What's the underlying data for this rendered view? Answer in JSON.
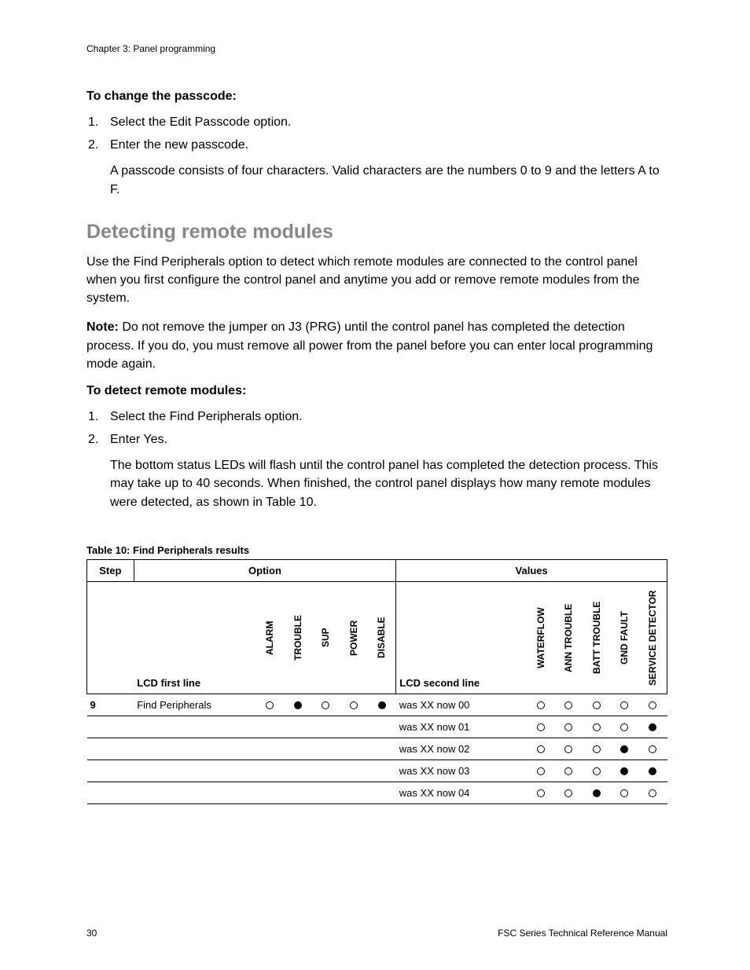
{
  "chapter": "Chapter 3: Panel programming",
  "passcode": {
    "heading": "To change the passcode:",
    "steps": [
      "Select the Edit Passcode option.",
      "Enter the new passcode."
    ],
    "followup": "A passcode consists of four characters. Valid characters are the numbers 0 to 9 and the letters A to F."
  },
  "section_title": "Detecting remote modules",
  "intro": "Use the Find Peripherals option to detect which remote modules are connected to the control panel when you first configure the control panel and anytime you add or remove remote modules from the system.",
  "note": {
    "label": "Note:",
    "text": " Do not remove the jumper on J3 (PRG) until the control panel has completed the detection process. If you do, you must remove all power from the panel before you can enter local programming mode again."
  },
  "detect": {
    "heading": "To detect remote modules:",
    "steps": [
      "Select the Find Peripherals option.",
      "Enter Yes."
    ],
    "followup": "The bottom status LEDs will flash until the control panel has completed the detection process. This may take up to 40 seconds. When finished, the control panel displays how many remote modules were detected, as shown in Table 10."
  },
  "table": {
    "caption": "Table 10: Find Peripherals results",
    "head": {
      "step": "Step",
      "option": "Option",
      "values": "Values",
      "lcd1": "LCD first line",
      "lcd2": "LCD second line",
      "indA": [
        "ALARM",
        "TROUBLE",
        "SUP",
        "POWER",
        "DISABLE"
      ],
      "indB": [
        "WATERFLOW",
        "ANN TROUBLE",
        "BATT TROUBLE",
        "GND FAULT",
        "SERVICE DETECTOR"
      ]
    },
    "rows": [
      {
        "step": "9",
        "lcd1": "Find Peripherals",
        "a": [
          0,
          1,
          0,
          0,
          1
        ],
        "lcd2": "was XX now 00",
        "b": [
          0,
          0,
          0,
          0,
          0
        ]
      },
      {
        "step": "",
        "lcd1": "",
        "a": null,
        "lcd2": "was XX now 01",
        "b": [
          0,
          0,
          0,
          0,
          1
        ]
      },
      {
        "step": "",
        "lcd1": "",
        "a": null,
        "lcd2": "was XX now 02",
        "b": [
          0,
          0,
          0,
          1,
          0
        ]
      },
      {
        "step": "",
        "lcd1": "",
        "a": null,
        "lcd2": "was XX now 03",
        "b": [
          0,
          0,
          0,
          1,
          1
        ]
      },
      {
        "step": "",
        "lcd1": "",
        "a": null,
        "lcd2": "was XX now 04",
        "b": [
          0,
          0,
          1,
          0,
          0
        ]
      }
    ]
  },
  "footer": {
    "page": "30",
    "manual": "FSC Series Technical Reference Manual"
  }
}
